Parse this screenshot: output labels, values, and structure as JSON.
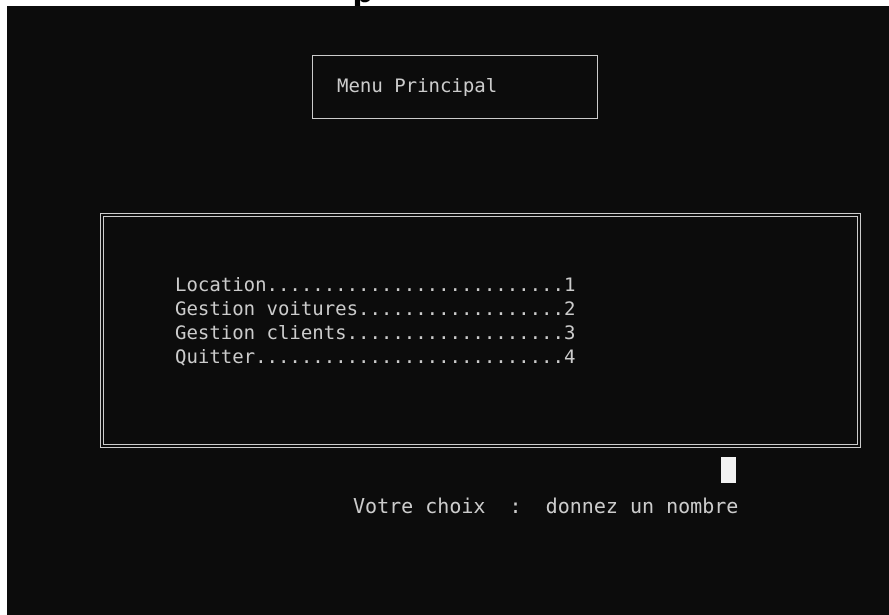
{
  "top_glyph": "p",
  "title": "Menu Principal",
  "menu": {
    "items": [
      {
        "label": "Location",
        "dots": "..........................",
        "number": "1"
      },
      {
        "label": "Gestion voitures",
        "dots": "..................",
        "number": "2"
      },
      {
        "label": "Gestion clients",
        "dots": "...................",
        "number": "3"
      },
      {
        "label": "Quitter",
        "dots": "...........................",
        "number": "4"
      }
    ]
  },
  "prompt": {
    "text": "Votre choix  :  donnez un nombre"
  },
  "colors": {
    "background": "#0c0c0c",
    "foreground": "#cccccc",
    "cursor": "#f2f2f2"
  }
}
